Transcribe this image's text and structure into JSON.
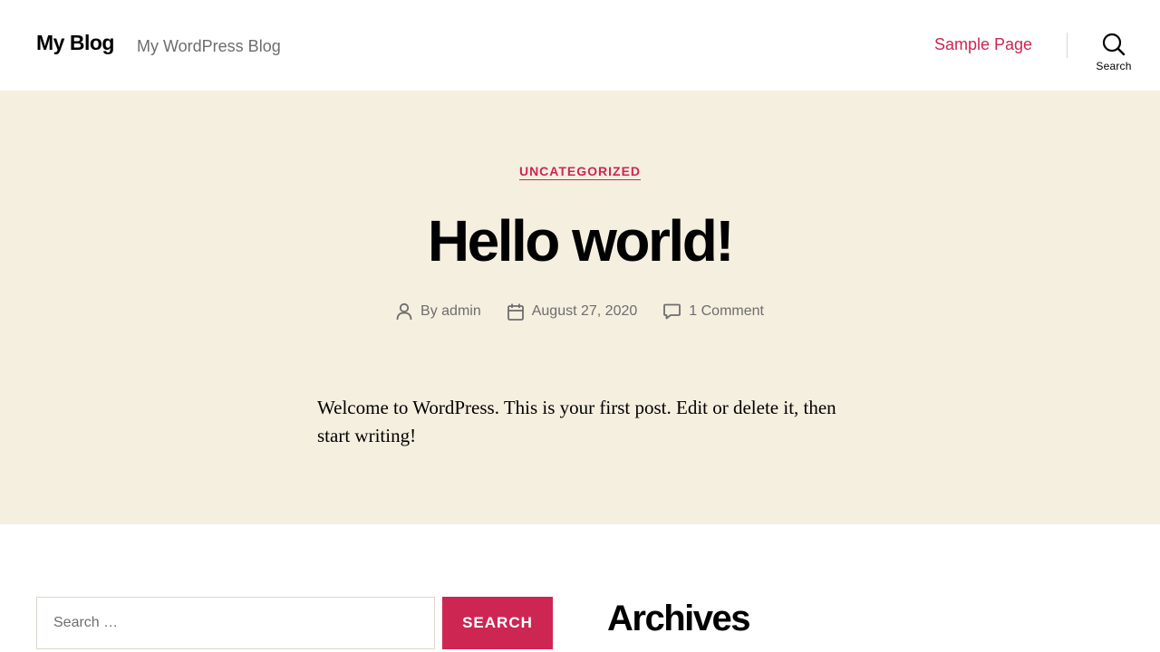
{
  "header": {
    "site_title": "My Blog",
    "site_description": "My WordPress Blog",
    "nav": [
      {
        "label": "Sample Page"
      }
    ],
    "search_toggle_label": "Search"
  },
  "post": {
    "category": "UNCATEGORIZED",
    "title": "Hello world!",
    "meta": {
      "author_prefix": "By",
      "author": "admin",
      "date": "August 27, 2020",
      "comments": "1 Comment"
    },
    "content": "Welcome to WordPress. This is your first post. Edit or delete it, then start writing!"
  },
  "widgets": {
    "search": {
      "placeholder": "Search …",
      "button_label": "SEARCH"
    },
    "archives_title": "Archives"
  },
  "icons": {
    "search": "search-icon",
    "author": "person-icon",
    "date": "calendar-icon",
    "comments": "comment-icon"
  },
  "colors": {
    "accent": "#cd2653",
    "hero_background": "#f5efe0",
    "meta_text": "#6d6d6d",
    "border": "#dcd7ca"
  }
}
